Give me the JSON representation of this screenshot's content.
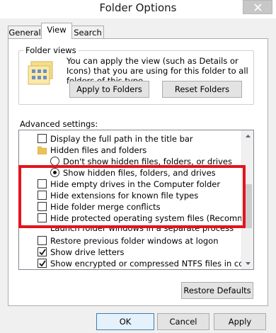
{
  "window": {
    "title": "Folder Options",
    "close_label": "×"
  },
  "tabs": [
    {
      "label": "General"
    },
    {
      "label": "View"
    },
    {
      "label": "Search"
    }
  ],
  "folder_views": {
    "label": "Folder views",
    "description": "You can apply the view (such as Details or Icons) that you are using for this folder to all folders of this type.",
    "apply_button": "Apply to Folders",
    "reset_button": "Reset Folders"
  },
  "advanced": {
    "label": "Advanced settings:",
    "items": [
      {
        "type": "checkbox",
        "checked": false,
        "indent": 0,
        "label": "Display the full path in the title bar"
      },
      {
        "type": "folder",
        "indent": 0,
        "label": "Hidden files and folders"
      },
      {
        "type": "radio",
        "checked": false,
        "indent": 1,
        "label": "Don't show hidden files, folders, or drives"
      },
      {
        "type": "radio",
        "checked": true,
        "indent": 1,
        "label": "Show hidden files, folders, and drives"
      },
      {
        "type": "checkbox",
        "checked": false,
        "indent": 0,
        "label": "Hide empty drives in the Computer folder"
      },
      {
        "type": "checkbox",
        "checked": false,
        "indent": 0,
        "label": "Hide extensions for known file types"
      },
      {
        "type": "checkbox",
        "checked": false,
        "indent": 0,
        "label": "Hide folder merge conflicts"
      },
      {
        "type": "checkbox",
        "checked": false,
        "indent": 0,
        "label": "Hide protected operating system files (Recommended)"
      },
      {
        "type": "checkbox",
        "checked": false,
        "indent": 0,
        "label": "Launch folder windows in a separate process"
      },
      {
        "type": "checkbox",
        "checked": false,
        "indent": 0,
        "label": "Restore previous folder windows at logon"
      },
      {
        "type": "checkbox",
        "checked": true,
        "indent": 0,
        "label": "Show drive letters"
      },
      {
        "type": "checkbox",
        "checked": true,
        "indent": 0,
        "label": "Show encrypted or compressed NTFS files in color"
      }
    ],
    "restore_button": "Restore Defaults"
  },
  "footer": {
    "ok": "OK",
    "cancel": "Cancel",
    "apply": "Apply"
  },
  "colors": {
    "highlight": "#e3141e",
    "default_button_border": "#3c7fb1"
  },
  "icons": [
    "close-icon",
    "folder-views-icon",
    "folder-icon",
    "checkmark-icon",
    "scroll-up-icon",
    "scroll-down-icon"
  ]
}
